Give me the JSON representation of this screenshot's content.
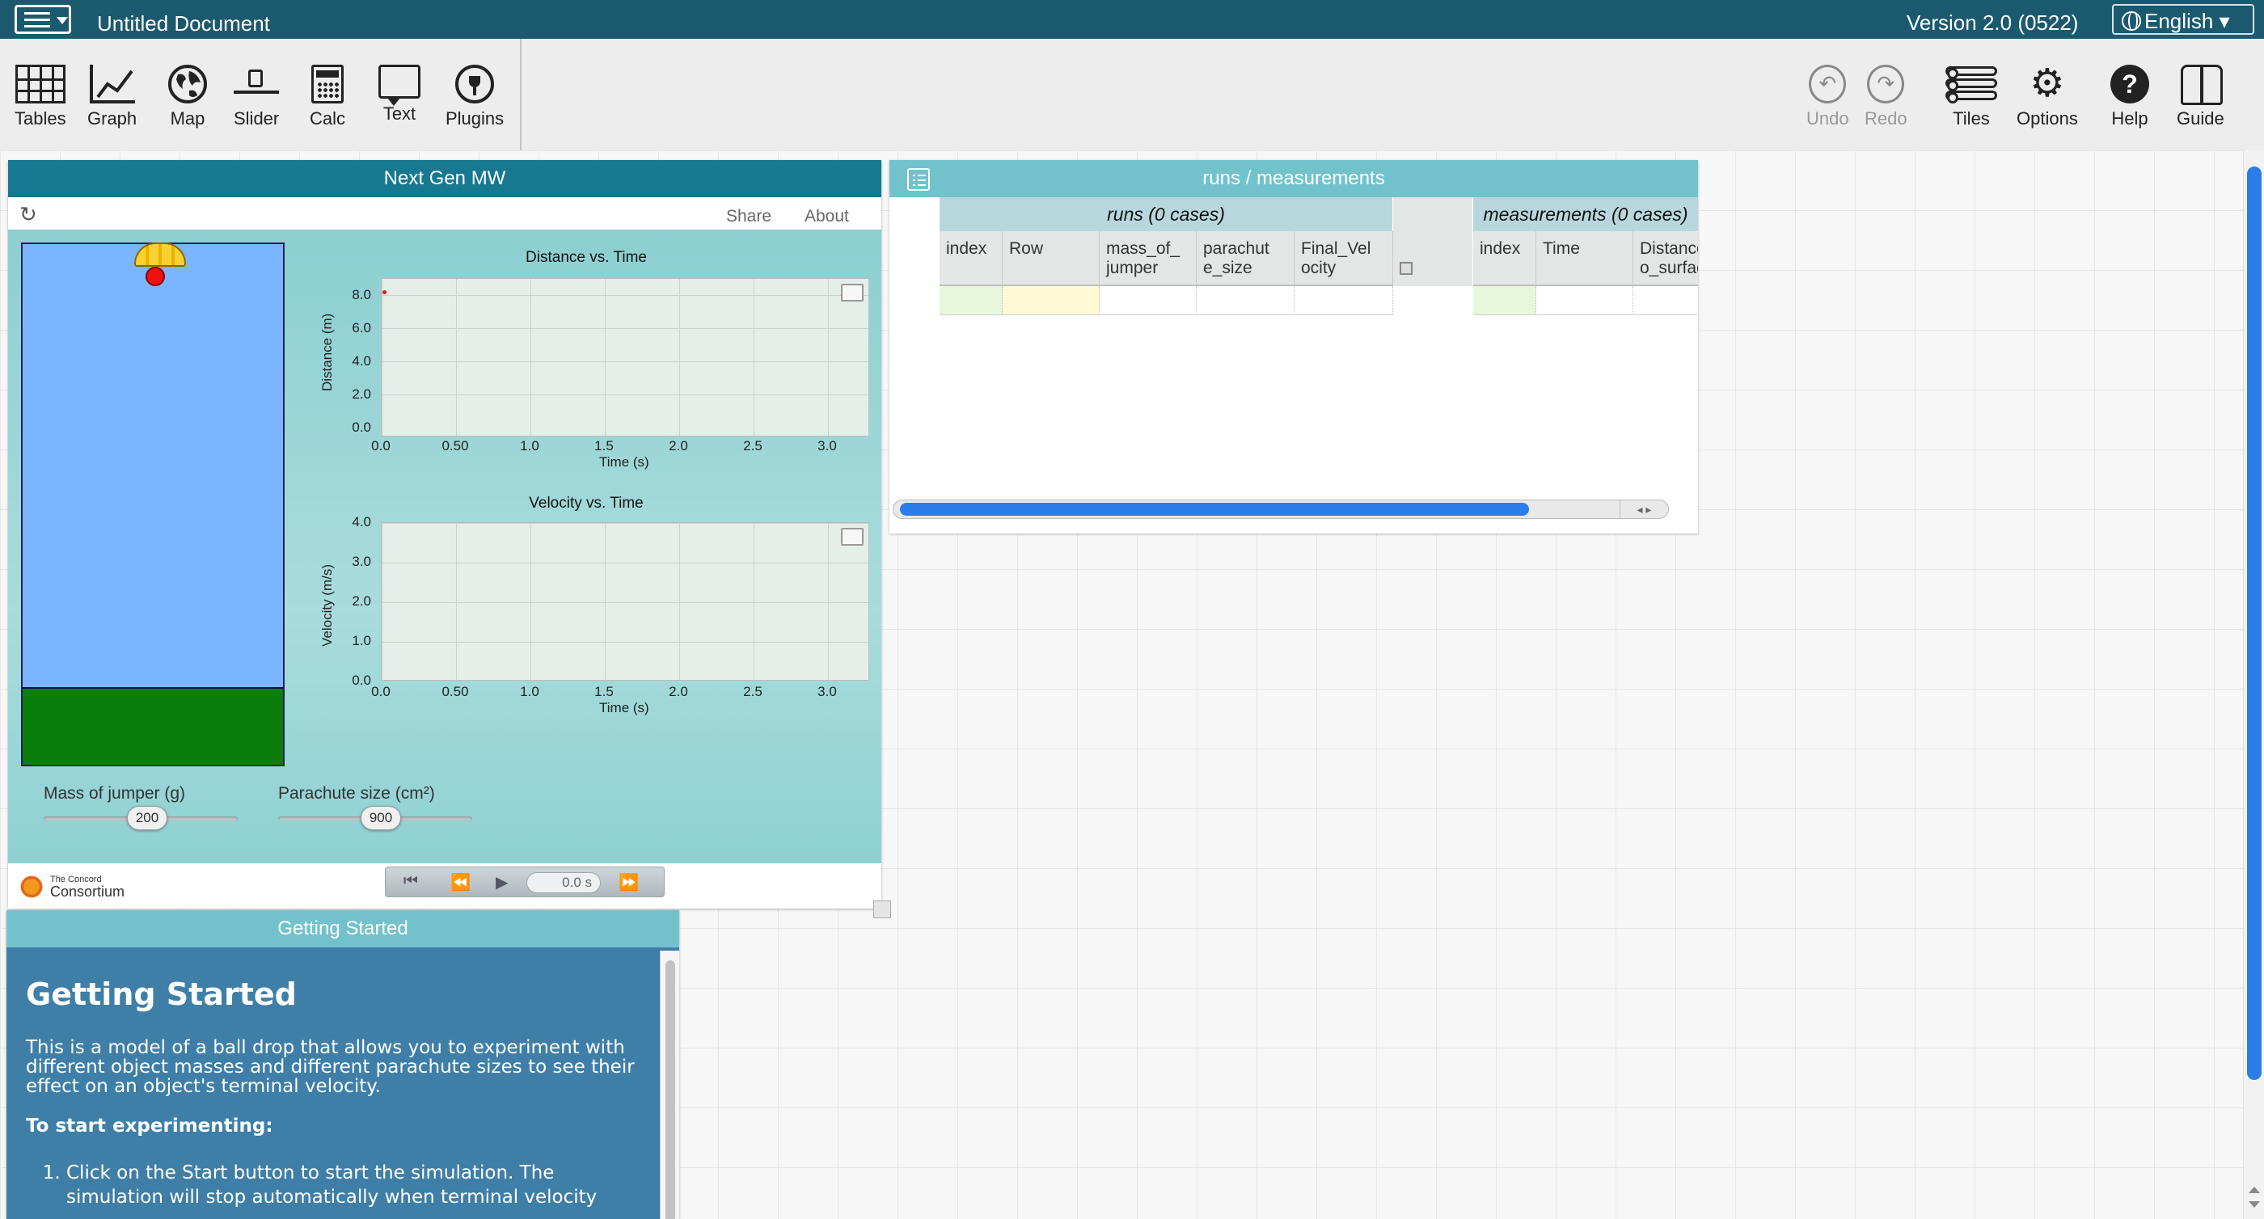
{
  "menubar": {
    "document_title": "Untitled Document",
    "version": "Version 2.0 (0522)",
    "language": "English ▾"
  },
  "toolshelf": {
    "tools": [
      {
        "label": "Tables",
        "icon": "table-icon"
      },
      {
        "label": "Graph",
        "icon": "graph-icon"
      },
      {
        "label": "Map",
        "icon": "map-icon"
      },
      {
        "label": "Slider",
        "icon": "slider-icon"
      },
      {
        "label": "Calc",
        "icon": "calculator-icon"
      },
      {
        "label": "Text",
        "icon": "text-icon"
      },
      {
        "label": "Plugins",
        "icon": "plugin-icon"
      }
    ],
    "right_tools": [
      {
        "label": "Undo",
        "icon": "undo-icon",
        "enabled": false
      },
      {
        "label": "Redo",
        "icon": "redo-icon",
        "enabled": false
      },
      {
        "label": "Tiles",
        "icon": "tiles-icon"
      },
      {
        "label": "Options",
        "icon": "gear-icon"
      },
      {
        "label": "Help",
        "icon": "help-icon"
      },
      {
        "label": "Guide",
        "icon": "guide-icon"
      }
    ]
  },
  "mw_tile": {
    "title": "Next Gen MW",
    "share": "Share",
    "about": "About",
    "distance_chart": {
      "title": "Distance vs. Time",
      "ylabel": "Distance (m)",
      "xlabel": "Time (s)",
      "yticks": [
        "8.0",
        "6.0",
        "4.0",
        "2.0",
        "0.0"
      ],
      "xticks": [
        "0.0",
        "0.50",
        "1.0",
        "1.5",
        "2.0",
        "2.5",
        "3.0"
      ]
    },
    "velocity_chart": {
      "title": "Velocity vs. Time",
      "ylabel": "Velocity (m/s)",
      "xlabel": "Time (s)",
      "yticks": [
        "4.0",
        "3.0",
        "2.0",
        "1.0",
        "0.0"
      ],
      "xticks": [
        "0.0",
        "0.50",
        "1.0",
        "1.5",
        "2.0",
        "2.5",
        "3.0"
      ]
    },
    "mass_label": "Mass of jumper (g)",
    "mass_value": "200",
    "chute_label": "Parachute size (cm²)",
    "chute_value": "900",
    "time_display": "0.0 s",
    "logo_small": "The Concord",
    "logo_large": "Consortium"
  },
  "table_tile": {
    "title": "runs / measurements",
    "runs_header": "runs (0 cases)",
    "measurements_header": "measurements (0 cases)",
    "runs_columns": [
      "index",
      "Row",
      "mass_of_ jumper",
      "parachut e_size",
      "Final_Vel ocity"
    ],
    "measurement_columns": [
      "index",
      "Time",
      "Distance_t o_surface"
    ]
  },
  "getting_started": {
    "title": "Getting Started",
    "heading": "Getting Started",
    "intro": "This is a model of a ball drop that allows you to experiment with different object masses and different parachute sizes to see their effect on an object's terminal velocity.",
    "subheading": "To start experimenting:",
    "steps": [
      "Click on the Start button to start the simulation. The simulation will stop automatically when terminal velocity"
    ]
  }
}
